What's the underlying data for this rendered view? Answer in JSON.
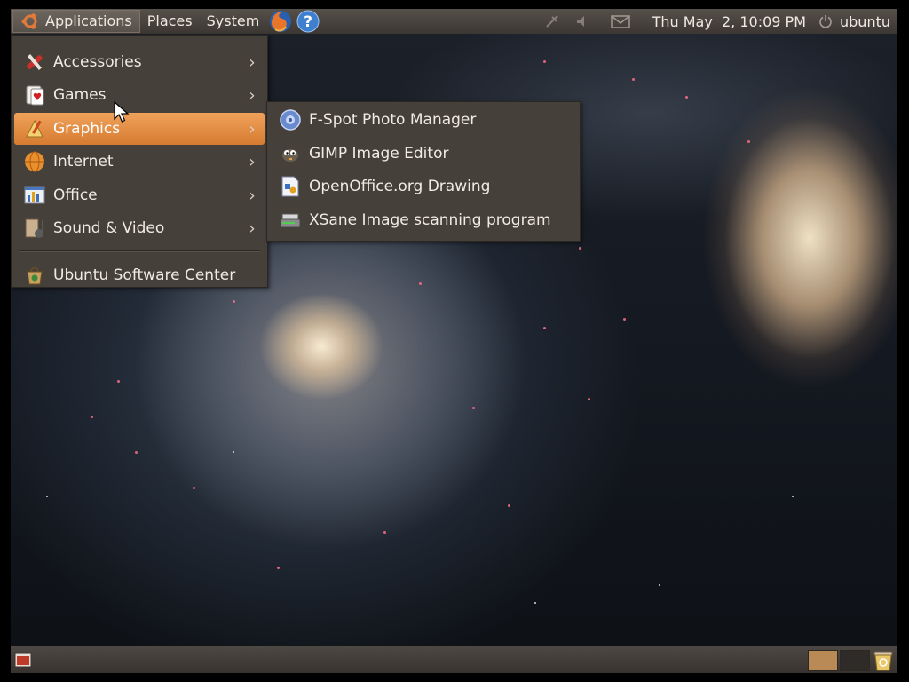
{
  "top_panel": {
    "menus": [
      "Applications",
      "Places",
      "System"
    ],
    "clock": "Thu May  2, 10:09 PM",
    "user": "ubuntu",
    "icons": [
      "ubuntu-logo-icon",
      "firefox-icon",
      "help-icon",
      "network-icon",
      "volume-icon",
      "mail-icon",
      "power-icon"
    ]
  },
  "applications_menu": {
    "items": [
      {
        "label": "Accessories",
        "icon": "accessories-icon",
        "submenu": true
      },
      {
        "label": "Games",
        "icon": "games-icon",
        "submenu": true
      },
      {
        "label": "Graphics",
        "icon": "graphics-icon",
        "submenu": true,
        "highlighted": true
      },
      {
        "label": "Internet",
        "icon": "internet-icon",
        "submenu": true
      },
      {
        "label": "Office",
        "icon": "office-icon",
        "submenu": true
      },
      {
        "label": "Sound & Video",
        "icon": "sound-video-icon",
        "submenu": true
      }
    ],
    "footer_item": {
      "label": "Ubuntu Software Center",
      "icon": "software-center-icon"
    }
  },
  "graphics_submenu": {
    "items": [
      {
        "label": "F-Spot Photo Manager",
        "icon": "fspot-icon"
      },
      {
        "label": "GIMP Image Editor",
        "icon": "gimp-icon"
      },
      {
        "label": "OpenOffice.org Drawing",
        "icon": "oo-draw-icon"
      },
      {
        "label": "XSane Image scanning program",
        "icon": "xsane-icon"
      }
    ]
  },
  "colors": {
    "panel": "#3c3733",
    "menu_bg": "#46403a",
    "highlight": "#e08a3e"
  }
}
